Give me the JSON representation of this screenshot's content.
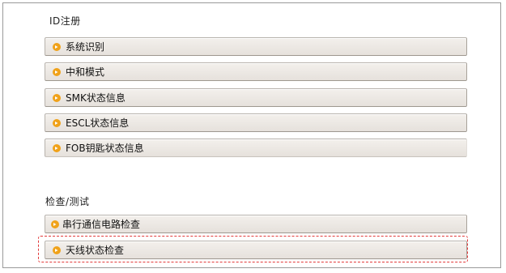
{
  "sections": {
    "id_registration": {
      "title": "ID注册",
      "items": [
        {
          "label": "系统识别"
        },
        {
          "label": "中和模式"
        },
        {
          "label": "SMK状态信息"
        },
        {
          "label": "ESCL状态信息"
        },
        {
          "label": "FOB钥匙状态信息"
        }
      ]
    },
    "check_test": {
      "title": "检查/测试",
      "items": [
        {
          "label": "串行通信电路检查"
        },
        {
          "label": "天线状态检查"
        }
      ]
    }
  },
  "icons": {
    "menu_arrow": "arrow-right-circle-icon",
    "arrow_color": "#f0a21a"
  },
  "highlight": {
    "color": "#e23a3a",
    "target": "天线状态检查"
  }
}
